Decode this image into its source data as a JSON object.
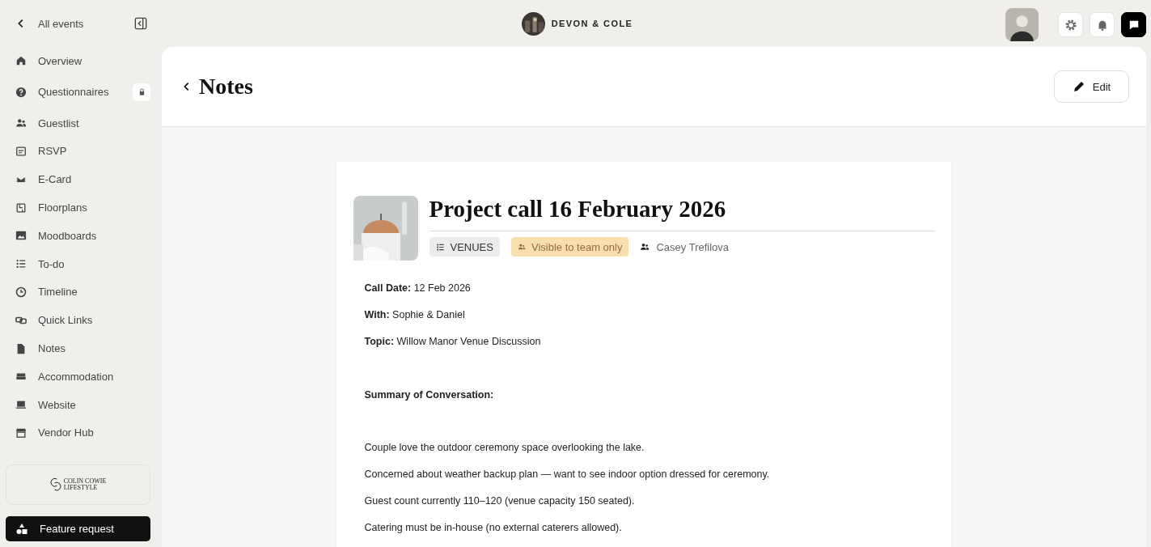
{
  "sidebar": {
    "back_label": "All events",
    "items": [
      {
        "label": "Overview"
      },
      {
        "label": "Questionnaires",
        "locked": true
      },
      {
        "label": "Guestlist"
      },
      {
        "label": "RSVP"
      },
      {
        "label": "E-Card"
      },
      {
        "label": "Floorplans"
      },
      {
        "label": "Moodboards"
      },
      {
        "label": "To-do"
      },
      {
        "label": "Timeline"
      },
      {
        "label": "Quick Links"
      },
      {
        "label": "Notes"
      },
      {
        "label": "Accommodation"
      },
      {
        "label": "Website"
      },
      {
        "label": "Vendor Hub"
      }
    ],
    "brand": [
      "COLIN COWIE",
      "LIFESTYLE"
    ],
    "feature_button": "Feature request"
  },
  "topbar": {
    "event_name": "DEVON & COLE"
  },
  "page": {
    "title": "Notes",
    "edit_button": "Edit"
  },
  "note": {
    "title": "Project call 16 February 2026",
    "category": "VENUES",
    "visibility": "Visible to team only",
    "author": "Casey Trefilova",
    "body": [
      {
        "kind": "field",
        "text": "**Call Date:** 12 Feb 2026"
      },
      {
        "kind": "field",
        "text": "**With:** Sophie & Daniel"
      },
      {
        "kind": "field",
        "text": "**Topic:** Willow Manor Venue Discussion"
      },
      {
        "kind": "heading",
        "text": "Summary of Conversation:"
      },
      {
        "kind": "line",
        "text": "Couple love the outdoor ceremony space overlooking the lake."
      },
      {
        "kind": "line",
        "text": "Concerned about weather backup plan — want to see indoor option dressed for ceremony."
      },
      {
        "kind": "line",
        "text": "Guest count currently 110–120 (venue capacity 150 seated)."
      },
      {
        "kind": "line",
        "text": "Catering must be in-house (no external caterers allowed)."
      }
    ]
  }
}
